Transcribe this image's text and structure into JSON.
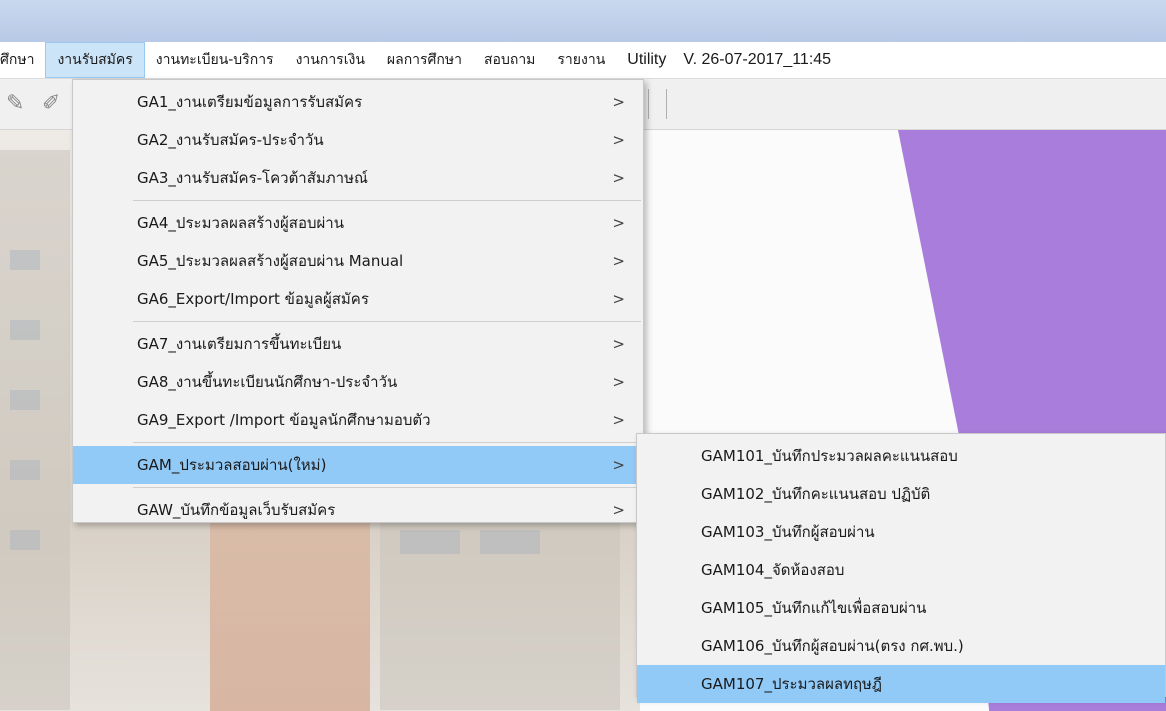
{
  "menubar": {
    "items": [
      "ศึกษา",
      "งานรับสมัคร",
      "งานทะเบียน-บริการ",
      "งานการเงิน",
      "ผลการศึกษา",
      "สอบถาม",
      "รายงาน",
      "Utility"
    ],
    "version": "V. 26-07-2017_11:45"
  },
  "toolbar": {
    "icons": [
      "edit-add-icon",
      "pencil-icon"
    ]
  },
  "submenu": {
    "items": [
      "GA1_งานเตรียมข้อมูลการรับสมัคร",
      "GA2_งานรับสมัคร-ประจำวัน",
      "GA3_งานรับสมัคร-โควต้าสัมภาษณ์",
      "GA4_ประมวลผลสร้างผู้สอบผ่าน",
      "GA5_ประมวลผลสร้างผู้สอบผ่าน Manual",
      "GA6_Export/Import ข้อมูลผู้สมัคร",
      "GA7_งานเตรียมการขึ้นทะเบียน",
      "GA8_งานขึ้นทะเบียนนักศึกษา-ประจำวัน",
      "GA9_Export /Import ข้อมูลนักศึกษามอบตัว",
      "GAM_ประมวลสอบผ่าน(ใหม่)",
      "GAW_บันทึกข้อมูลเว็บรับสมัคร"
    ],
    "arrow": ">"
  },
  "gam_submenu": {
    "items": [
      "GAM101_บันทึกประมวลผลคะแนนสอบ",
      "GAM102_บันทึกคะแนนสอบ ปฏิบัติ",
      "GAM103_บันทึกผู้สอบผ่าน",
      "GAM104_จัดห้องสอบ",
      "GAM105_บันทึกแก้ไขเพื่อสอบผ่าน",
      "GAM106_บันทึกผู้สอบผ่าน(ตรง กศ.พบ.)",
      "GAM107_ประมวลผลทฤษฎี"
    ]
  }
}
